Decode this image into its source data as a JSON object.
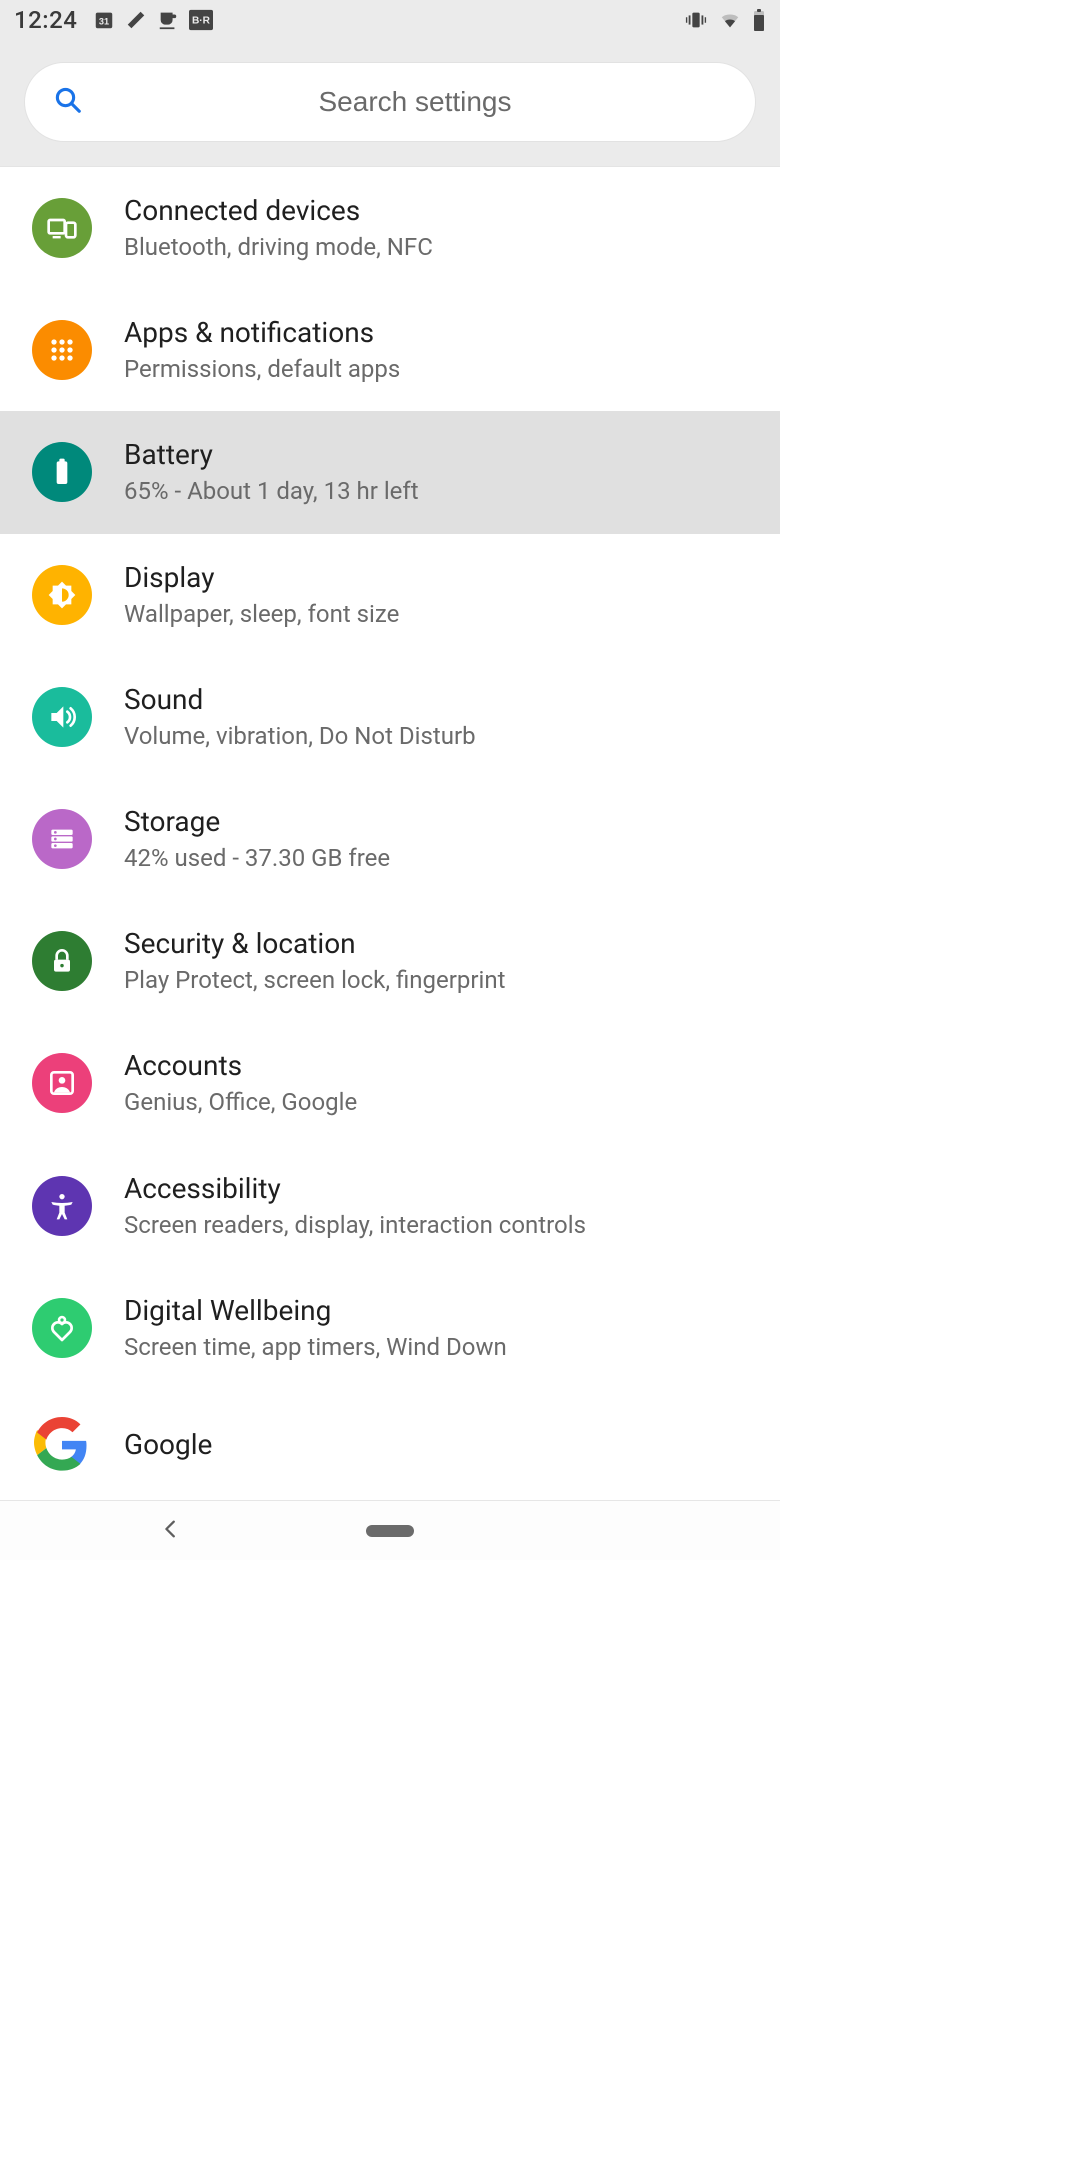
{
  "statusbar": {
    "time": "12:24",
    "notif_icons": [
      "calendar-31",
      "pencil",
      "coffee-cup",
      "br-badge"
    ],
    "right_icons": [
      "vibrate",
      "wifi",
      "battery"
    ]
  },
  "search": {
    "placeholder": "Search settings"
  },
  "items": [
    {
      "id": "connected-devices",
      "title": "Connected devices",
      "subtitle": "Bluetooth, driving mode, NFC",
      "icon": "devices",
      "color": "#689f38",
      "highlight": false
    },
    {
      "id": "apps",
      "title": "Apps & notifications",
      "subtitle": "Permissions, default apps",
      "icon": "apps",
      "color": "#fb8c00",
      "highlight": false
    },
    {
      "id": "battery",
      "title": "Battery",
      "subtitle": "65% - About 1 day, 13 hr left",
      "icon": "battery",
      "color": "#00897b",
      "highlight": true
    },
    {
      "id": "display",
      "title": "Display",
      "subtitle": "Wallpaper, sleep, font size",
      "icon": "brightness",
      "color": "#ffb300",
      "highlight": false
    },
    {
      "id": "sound",
      "title": "Sound",
      "subtitle": "Volume, vibration, Do Not Disturb",
      "icon": "volume",
      "color": "#1abc9c",
      "highlight": false
    },
    {
      "id": "storage",
      "title": "Storage",
      "subtitle": "42% used - 37.30 GB free",
      "icon": "storage",
      "color": "#ba68c8",
      "highlight": false
    },
    {
      "id": "security",
      "title": "Security & location",
      "subtitle": "Play Protect, screen lock, fingerprint",
      "icon": "lock",
      "color": "#2e7d32",
      "highlight": false
    },
    {
      "id": "accounts",
      "title": "Accounts",
      "subtitle": "Genius, Office, Google",
      "icon": "account",
      "color": "#ec407a",
      "highlight": false
    },
    {
      "id": "accessibility",
      "title": "Accessibility",
      "subtitle": "Screen readers, display, interaction controls",
      "icon": "accessibility",
      "color": "#5e35b1",
      "highlight": false
    },
    {
      "id": "wellbeing",
      "title": "Digital Wellbeing",
      "subtitle": "Screen time, app timers, Wind Down",
      "icon": "wellbeing",
      "color": "#2ecc71",
      "highlight": false
    },
    {
      "id": "google",
      "title": "Google",
      "subtitle": "",
      "icon": "google",
      "color": "#ffffff",
      "highlight": false
    }
  ]
}
